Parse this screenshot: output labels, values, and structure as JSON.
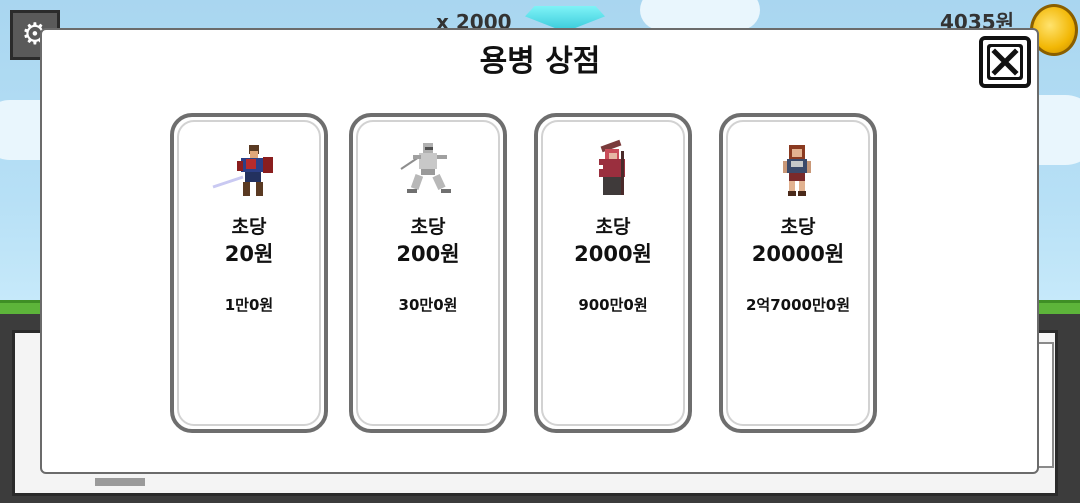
{
  "hud": {
    "settings_icon": "gear-icon",
    "gem_count": "x 2000",
    "money": "4035원",
    "gem_icon": "diamond-icon",
    "coin_icon": "coin-icon"
  },
  "shop": {
    "title": "용병 상점",
    "close_icon": "close-icon",
    "cards": [
      {
        "rate_label": "초당",
        "rate_value": "20원",
        "price": "1만0원",
        "sprite": "swordsman-mercenary"
      },
      {
        "rate_label": "초당",
        "rate_value": "200원",
        "price": "30만0원",
        "sprite": "ninja-mercenary"
      },
      {
        "rate_label": "초당",
        "rate_value": "2000원",
        "price": "900만0원",
        "sprite": "witch-mercenary"
      },
      {
        "rate_label": "초당",
        "rate_value": "20000원",
        "price": "2억7000만0원",
        "sprite": "warrior-woman-mercenary"
      }
    ]
  },
  "colors": {
    "sky": "#b7e0f6",
    "ground": "#5db43a",
    "modal_bg": "#ffffff",
    "card_border": "#6e6e6e",
    "bottom_panel": "#3c3c3c"
  }
}
